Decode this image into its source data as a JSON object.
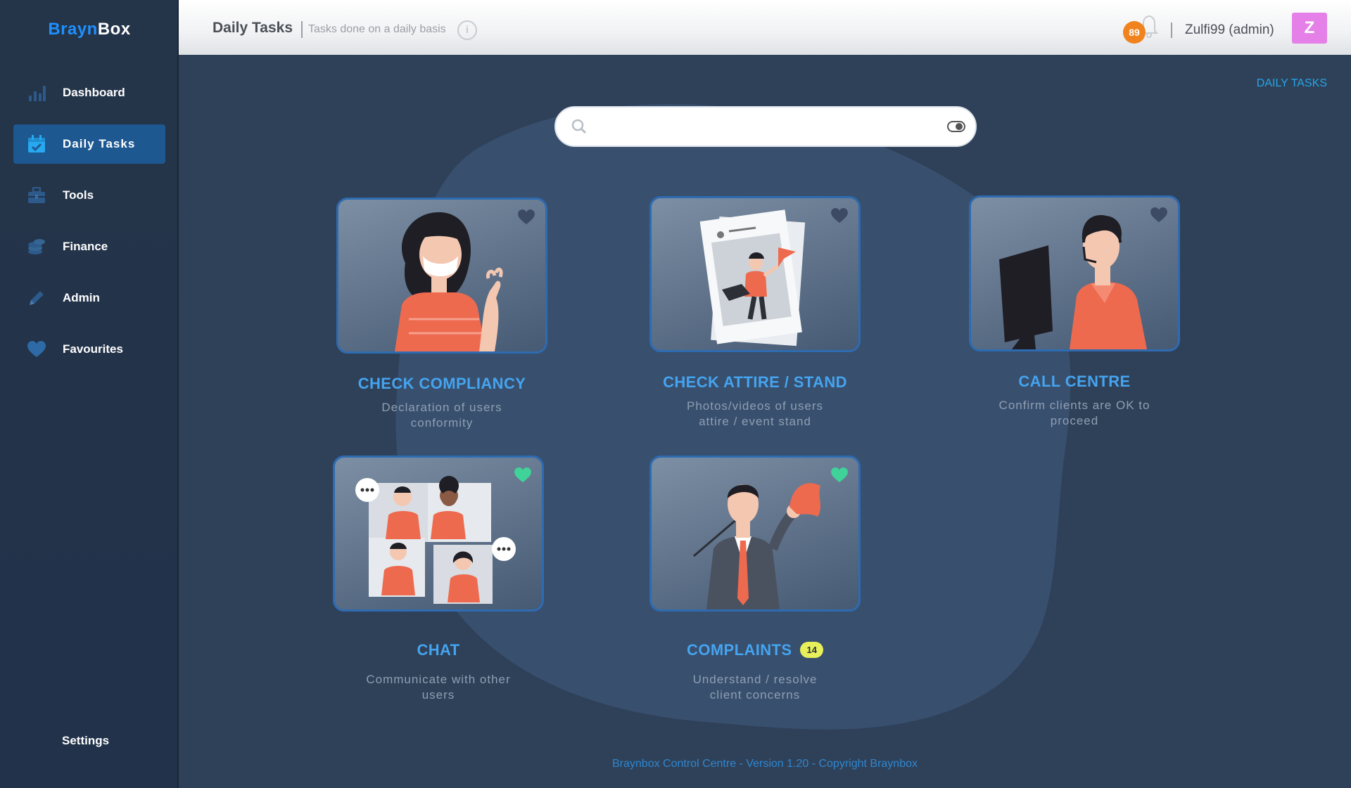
{
  "app": {
    "logo_part1": "Brayn",
    "logo_part2": "Box"
  },
  "sidebar": {
    "items": [
      {
        "label": "Dashboard",
        "icon": "bar-chart-icon"
      },
      {
        "label": "Daily Tasks",
        "icon": "calendar-check-icon"
      },
      {
        "label": "Tools",
        "icon": "toolbox-icon"
      },
      {
        "label": "Finance",
        "icon": "coins-icon"
      },
      {
        "label": "Admin",
        "icon": "pencil-icon"
      },
      {
        "label": "Favourites",
        "icon": "heart-icon"
      }
    ],
    "settings_label": "Settings"
  },
  "header": {
    "title": "Daily Tasks",
    "subtitle": "Tasks done on a daily basis",
    "info_glyph": "i",
    "notification_count": "89",
    "user": "Zulfi99  (admin)",
    "avatar_letter": "Z"
  },
  "breadcrumb": "DAILY TASKS",
  "search": {
    "value": "",
    "placeholder": ""
  },
  "cards": [
    {
      "title": "CHECK COMPLIANCY",
      "desc": "Declaration of users conformity",
      "favourited": false
    },
    {
      "title": "CHECK ATTIRE / STAND",
      "desc": "Photos/videos of users attire / event stand",
      "favourited": false
    },
    {
      "title": "CALL CENTRE",
      "desc": "Confirm clients are OK to proceed",
      "favourited": false
    },
    {
      "title": "CHAT",
      "desc": "Communicate with other users",
      "favourited": true
    },
    {
      "title": "COMPLAINTS",
      "desc": "Understand / resolve client concerns",
      "favourited": true,
      "badge": "14"
    }
  ],
  "footer": "Braynbox Control Centre - Version 1.20 - Copyright Braynbox",
  "colors": {
    "accent": "#1e90ff",
    "card_title": "#45a4ef",
    "fav_active": "#3fd39a",
    "fav_inactive": "#3c4b63",
    "badge_orange": "#f0831d",
    "badge_yellow": "#e7f05b"
  }
}
